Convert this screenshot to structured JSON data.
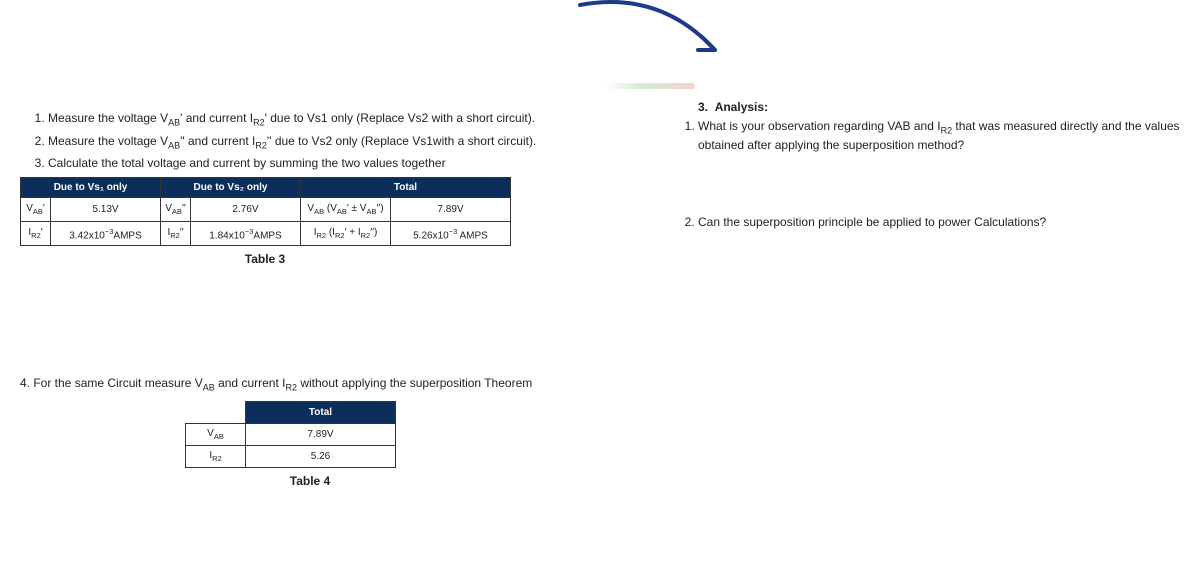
{
  "left": {
    "steps": [
      "Measure the voltage VAB' and current IR2' due to Vs1 only (Replace Vs2 with a short circuit).",
      "Measure the voltage VAB'' and current IR2'' due to Vs2 only (Replace Vs1 with a short circuit).",
      "Calculate the total voltage and current by summing the two values together"
    ],
    "table3": {
      "headers": {
        "h1": "Due to Vs₁ only",
        "h2": "Due to Vs₂ only",
        "h3": "Total"
      },
      "r1": {
        "l1": "VAB′",
        "v1": "5.13V",
        "l2": "VAB′′",
        "v2": "2.76V",
        "l3": "VAB (VAB′ ± VAB′′)",
        "v3": "7.89V"
      },
      "r2": {
        "l1": "IR2′",
        "v1": "3.42x10⁻³AMPS",
        "l2": "IR2′′",
        "v2": "1.84x10⁻³AMPS",
        "l3": "IR2 (IR2′ + IR2′′)",
        "v3": "5.26x10⁻³ AMPS"
      },
      "caption": "Table 3"
    },
    "para4": "4. For the same Circuit measure VAB and current IR2 without applying the superposition Theorem",
    "table4": {
      "header": "Total",
      "r1": {
        "l": "VAB",
        "v": "7.89V"
      },
      "r2": {
        "l": "IR2",
        "v": "5.26"
      },
      "caption": "Table 4"
    }
  },
  "right": {
    "analysis_num": "3.",
    "analysis_label": "Analysis:",
    "questions": [
      "What is your observation regarding VAB and IR2 that was measured directly and the values obtained after applying the superposition method?",
      "Can the superposition principle be applied to power Calculations?"
    ]
  }
}
